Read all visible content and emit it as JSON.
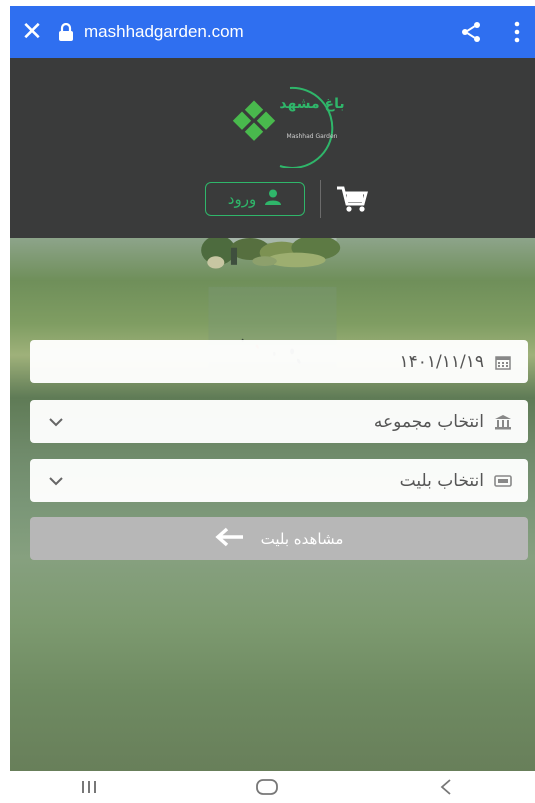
{
  "browser": {
    "url": "mashhadgarden.com",
    "accent_color": "#2f6ff0",
    "icons": [
      "close-icon",
      "lock-icon",
      "share-icon",
      "more-vert-icon"
    ]
  },
  "header": {
    "logo_text_main": "باغ مشهد",
    "logo_text_sub": "Mashhad Garden",
    "login_label": "ورود",
    "brand_color": "#2fb66a",
    "icons": [
      "user-icon",
      "cart-icon"
    ]
  },
  "form": {
    "date_value": "۱۴۰۱/۱۱/۱۹",
    "collection_placeholder": "انتخاب مجموعه",
    "ticket_placeholder": "انتخاب بلیت",
    "view_button_label": "مشاهده بلیت",
    "icons": [
      "calendar-icon",
      "museum-icon",
      "ticket-icon",
      "chevron-down-icon",
      "arrow-left-icon"
    ]
  },
  "system_nav": {
    "icons": [
      "recents-icon",
      "home-icon",
      "back-icon"
    ]
  }
}
